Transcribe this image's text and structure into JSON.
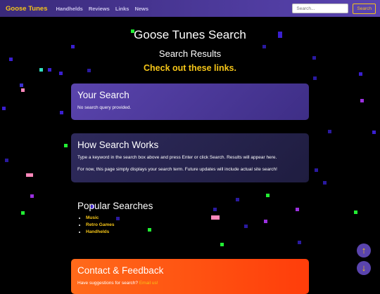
{
  "nav": {
    "brand": "Goose Tunes",
    "links": [
      "Handhelds",
      "Reviews",
      "Links",
      "News"
    ],
    "search_placeholder": "Search...",
    "search_button": "Search"
  },
  "header": {
    "title": "Goose Tunes Search",
    "subtitle": "Search Results",
    "tagline": "Check out these links."
  },
  "your_search": {
    "title": "Your Search",
    "text": "No search query provided."
  },
  "how_it_works": {
    "title": "How Search Works",
    "p1": "Type a keyword in the search box above and press Enter or click Search. Results will appear here.",
    "p2": "For now, this page simply displays your search term. Future updates will include actual site search!"
  },
  "popular": {
    "title": "Popular Searches",
    "items": [
      "Music",
      "Retro Games",
      "Handhelds"
    ]
  },
  "contact": {
    "title": "Contact & Feedback",
    "text": "Have suggestions for search?",
    "link": "Email us!"
  },
  "fab": {
    "up": "↑",
    "down": "↓"
  },
  "colors": {
    "accent": "#f5c518",
    "nav": "#4d3a9c",
    "card": "#5a44ad",
    "contact": "#ff4d0f"
  }
}
